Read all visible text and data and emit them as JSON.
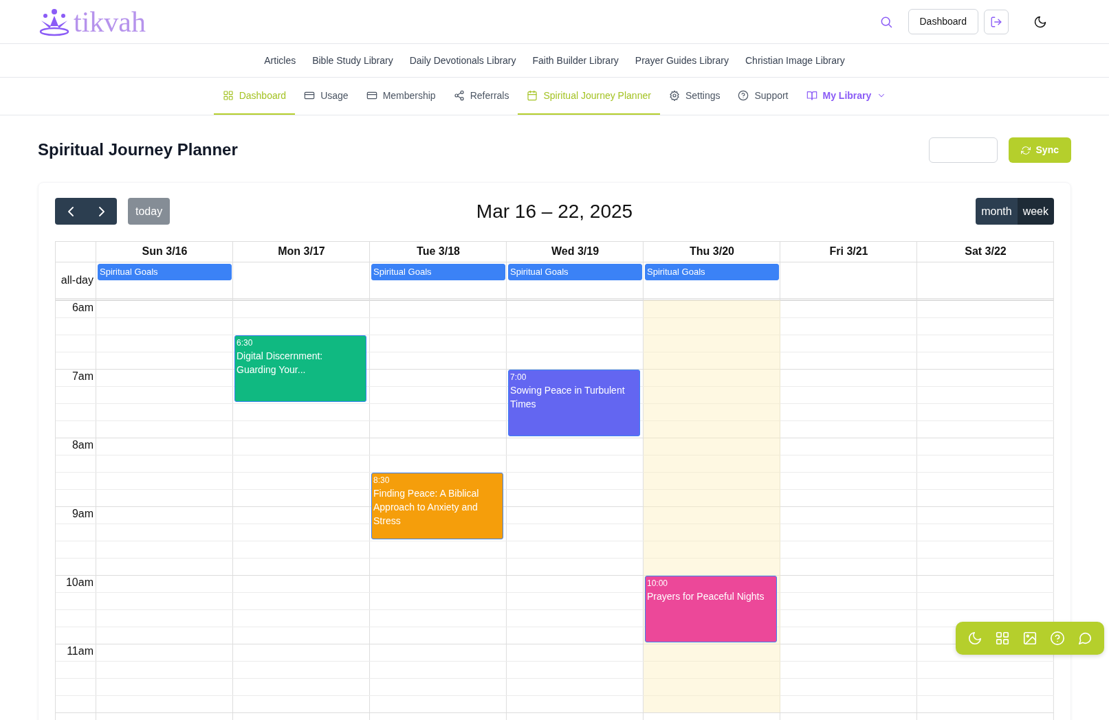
{
  "brand": {
    "name": "tikvah"
  },
  "header": {
    "dashboard_button": "Dashboard"
  },
  "library_nav": [
    "Articles",
    "Bible Study Library",
    "Daily Devotionals Library",
    "Faith Builder Library",
    "Prayer Guides Library",
    "Christian Image Library"
  ],
  "tabs": [
    {
      "label": "Dashboard",
      "selected": true,
      "kind": "link"
    },
    {
      "label": "Usage",
      "selected": false,
      "kind": "link"
    },
    {
      "label": "Membership",
      "selected": false,
      "kind": "link"
    },
    {
      "label": "Referrals",
      "selected": false,
      "kind": "link"
    },
    {
      "label": "Spiritual Journey Planner",
      "selected": true,
      "kind": "link"
    },
    {
      "label": "Settings",
      "selected": false,
      "kind": "link"
    },
    {
      "label": "Support",
      "selected": false,
      "kind": "link"
    },
    {
      "label": "My Library",
      "selected": false,
      "kind": "dropdown"
    }
  ],
  "page": {
    "title": "Spiritual Journey Planner",
    "sync_button": "Sync"
  },
  "calendar": {
    "today_button": {
      "label": "today",
      "disabled": true
    },
    "title": "Mar 16 – 22, 2025",
    "views": [
      {
        "label": "month",
        "selected": false
      },
      {
        "label": "week",
        "selected": true
      }
    ],
    "all_day_label": "all-day",
    "hours": [
      "6am",
      "7am",
      "8am",
      "9am",
      "10am",
      "11am"
    ],
    "days": [
      {
        "label": "Sun 3/16",
        "today": false,
        "all_day": [
          "Spiritual Goals"
        ]
      },
      {
        "label": "Mon 3/17",
        "today": false,
        "events": [
          {
            "time": "6:30",
            "title": "Digital Discernment: Guarding Your...",
            "color": "#10b981"
          }
        ]
      },
      {
        "label": "Tue 3/18",
        "today": false,
        "all_day": [
          "Spiritual Goals"
        ],
        "events": [
          {
            "time": "8:30",
            "title": "Finding Peace: A Biblical Approach to Anxiety and Stress",
            "color": "#f59e0b"
          }
        ]
      },
      {
        "label": "Wed 3/19",
        "today": false,
        "all_day": [
          "Spiritual Goals"
        ],
        "events": [
          {
            "time": "7:00",
            "title": "Sowing Peace in Turbulent Times",
            "color": "#6366f1"
          }
        ]
      },
      {
        "label": "Thu 3/20",
        "today": true,
        "all_day": [
          "Spiritual Goals"
        ],
        "events": [
          {
            "time": "10:00",
            "title": "Prayers for Peaceful Nights",
            "color": "#ec4899"
          }
        ]
      },
      {
        "label": "Fri 3/21",
        "today": false
      },
      {
        "label": "Sat 3/22",
        "today": false
      }
    ]
  }
}
